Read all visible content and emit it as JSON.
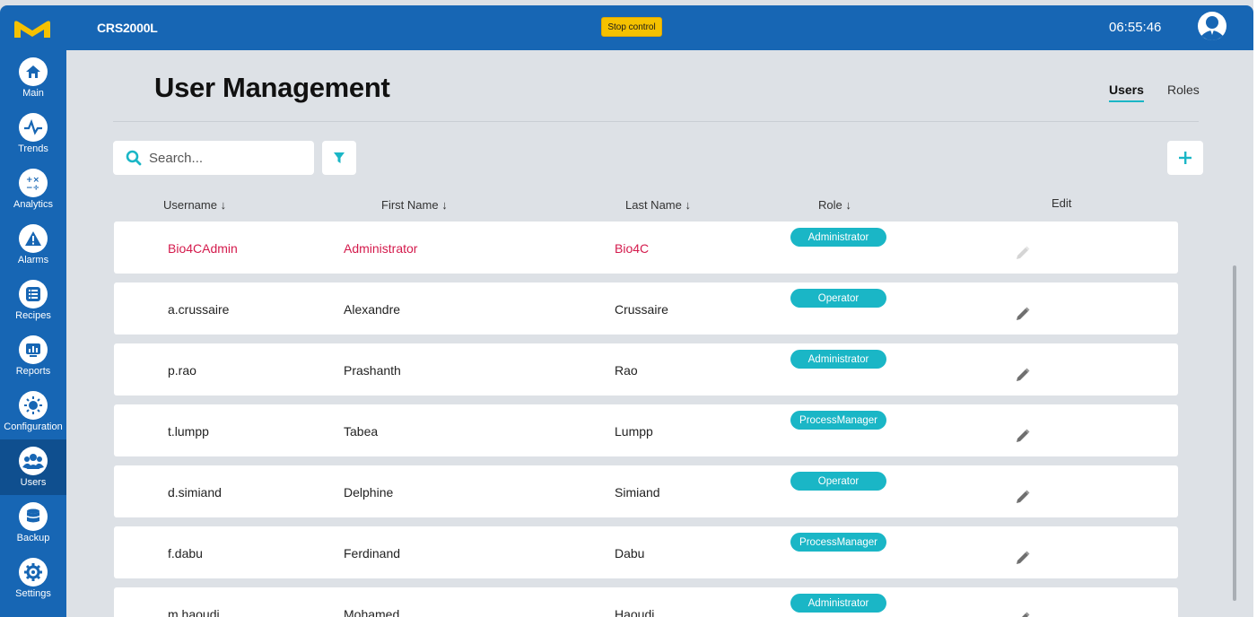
{
  "topbar": {
    "device_name": "CRS2000L",
    "stop_control_label": "Stop control",
    "clock": "06:55:46",
    "logo_icon": "merck-m-logo",
    "avatar_icon": "user-avatar-icon",
    "color": "#1766b4",
    "stop_color": "#f5c100"
  },
  "sidebar": {
    "active": "Users",
    "items": [
      {
        "label": "Main",
        "icon": "home-icon"
      },
      {
        "label": "Trends",
        "icon": "pulse-icon"
      },
      {
        "label": "Analytics",
        "icon": "calculator-icon"
      },
      {
        "label": "Alarms",
        "icon": "warning-icon"
      },
      {
        "label": "Recipes",
        "icon": "list-icon"
      },
      {
        "label": "Reports",
        "icon": "report-icon"
      },
      {
        "label": "Configuration",
        "icon": "configuration-icon"
      },
      {
        "label": "Users",
        "icon": "users-icon"
      },
      {
        "label": "Backup",
        "icon": "database-icon"
      },
      {
        "label": "Settings",
        "icon": "gear-icon"
      }
    ]
  },
  "page": {
    "title": "User Management",
    "tabs": {
      "users": "Users",
      "roles": "Roles"
    },
    "active_tab": "Users",
    "search_placeholder": "Search...",
    "accent": "#1ab6c6",
    "admin_color": "#d41a4c"
  },
  "table": {
    "headers": {
      "username": "Username",
      "first_name": "First Name",
      "last_name": "Last Name",
      "role": "Role",
      "edit": "Edit"
    },
    "sort_arrow": "↓",
    "rows": [
      {
        "username": "Bio4CAdmin",
        "first_name": "Administrator",
        "last_name": "Bio4C",
        "role": "Administrator",
        "system": true
      },
      {
        "username": "a.crussaire",
        "first_name": "Alexandre",
        "last_name": "Crussaire",
        "role": "Operator"
      },
      {
        "username": "p.rao",
        "first_name": "Prashanth",
        "last_name": "Rao",
        "role": "Administrator"
      },
      {
        "username": "t.lumpp",
        "first_name": "Tabea",
        "last_name": "Lumpp",
        "role": "ProcessManager"
      },
      {
        "username": "d.simiand",
        "first_name": "Delphine",
        "last_name": "Simiand",
        "role": "Operator"
      },
      {
        "username": "f.dabu",
        "first_name": "Ferdinand",
        "last_name": "Dabu",
        "role": "ProcessManager"
      },
      {
        "username": "m.haoudi",
        "first_name": "Mohamed",
        "last_name": "Haoudi",
        "role": "Administrator"
      }
    ]
  }
}
